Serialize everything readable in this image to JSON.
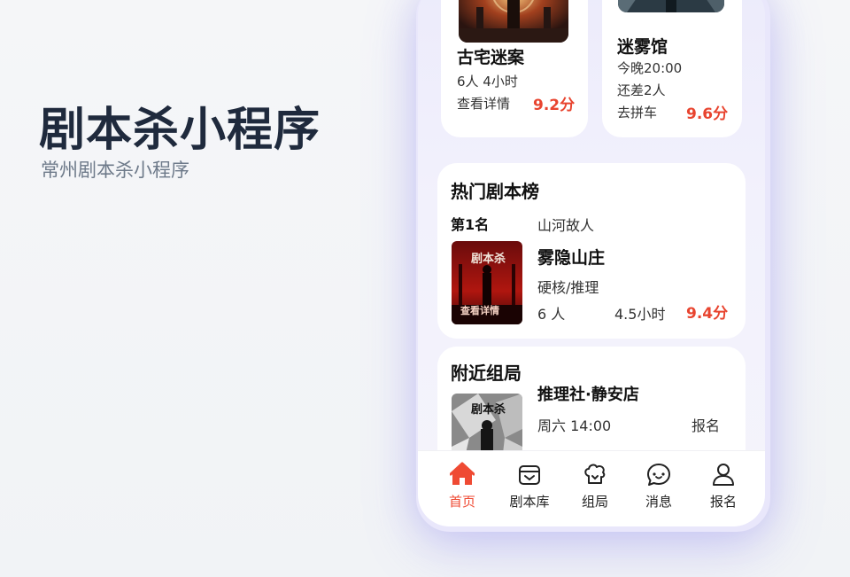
{
  "hero": {
    "title": "剧本杀小程序",
    "subtitle": "常州剧本杀小程序"
  },
  "cards_top": [
    {
      "name": "古宅迷案",
      "line1": "6人  4小时",
      "action": "查看详情",
      "score": "9.2分"
    },
    {
      "name": "迷雾馆",
      "line1": "今晚20:00",
      "line2": "还差2人",
      "action": "去拼车",
      "score": "9.6分"
    }
  ],
  "ranking": {
    "title": "热门剧本榜",
    "rank_label": "第1名",
    "rank_name": "山河故人",
    "thumb_title": "剧本杀",
    "thumb_caption": "查看详情",
    "script_name": "雾隐山庄",
    "genre": "硬核/推理",
    "players": "6 人",
    "duration": "4.5小时",
    "score": "9.4分"
  },
  "nearby": {
    "title": "附近组局",
    "thumb_title": "剧本杀",
    "venue": "推理社·静安店",
    "time": "周六 14:00",
    "action": "报名"
  },
  "tabs": [
    {
      "label": "首页",
      "icon": "home-icon",
      "active": true
    },
    {
      "label": "剧本库",
      "icon": "script-library-icon",
      "active": false
    },
    {
      "label": "组局",
      "icon": "group-icon",
      "active": false
    },
    {
      "label": "消息",
      "icon": "message-icon",
      "active": false
    },
    {
      "label": "报名",
      "icon": "user-icon",
      "active": false
    }
  ],
  "colors": {
    "accent": "#e8442f",
    "tab_active": "#ef4a33",
    "title": "#1f2a3d",
    "phone_glow": "#6b4ff0"
  }
}
